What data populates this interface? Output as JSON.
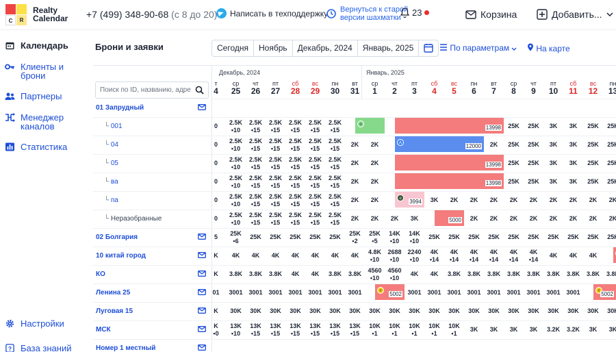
{
  "brand": {
    "line1": "Realty",
    "line2": "Calendar",
    "logo_letters": [
      "C",
      "R"
    ]
  },
  "header": {
    "phone": "+7 (499) 348-90-68",
    "hours": "(с 8 до 20)",
    "support": "Написать в техподдержку",
    "old_version_l1": "Вернуться к старой",
    "old_version_l2": "версии шахматки",
    "notifications": "23",
    "cart": "Корзина",
    "add": "Добавить..."
  },
  "sidebar": {
    "items": [
      {
        "label": "Календарь",
        "icon": "calendar-icon"
      },
      {
        "label_l1": "Клиенты и",
        "label_l2": "брони",
        "icon": "key-icon"
      },
      {
        "label": "Партнеры",
        "icon": "users-icon"
      },
      {
        "label_l1": "Менеджер",
        "label_l2": "каналов",
        "icon": "channels-icon"
      },
      {
        "label": "Статистика",
        "icon": "chart-icon"
      }
    ],
    "settings": "Настройки",
    "knowledge": "База знаний"
  },
  "toolbar": {
    "title": "Брони и заявки",
    "buttons": [
      "Сегодня",
      "Ноябрь",
      "Декабрь, 2024",
      "Январь, 2025"
    ],
    "filter": "По параметрам",
    "map": "На карте"
  },
  "search": {
    "placeholder": "Поиск по ID, названию, адре"
  },
  "months": {
    "dec": "Декабрь, 2024",
    "jan": "Январь, 2025"
  },
  "days": [
    {
      "w": "т",
      "d": "4",
      "we": false
    },
    {
      "w": "ср",
      "d": "25",
      "we": false
    },
    {
      "w": "чт",
      "d": "26",
      "we": false
    },
    {
      "w": "пт",
      "d": "27",
      "we": false
    },
    {
      "w": "сб",
      "d": "28",
      "we": true
    },
    {
      "w": "вс",
      "d": "29",
      "we": true
    },
    {
      "w": "пн",
      "d": "30",
      "we": false
    },
    {
      "w": "вт",
      "d": "31",
      "we": false
    },
    {
      "w": "ср",
      "d": "1",
      "we": false
    },
    {
      "w": "чт",
      "d": "2",
      "we": false
    },
    {
      "w": "пт",
      "d": "3",
      "we": false
    },
    {
      "w": "сб",
      "d": "4",
      "we": true
    },
    {
      "w": "вс",
      "d": "5",
      "we": true
    },
    {
      "w": "пн",
      "d": "6",
      "we": false
    },
    {
      "w": "вт",
      "d": "7",
      "we": false
    },
    {
      "w": "ср",
      "d": "8",
      "we": false
    },
    {
      "w": "чт",
      "d": "9",
      "we": false
    },
    {
      "w": "пт",
      "d": "10",
      "we": false
    },
    {
      "w": "сб",
      "d": "11",
      "we": true
    },
    {
      "w": "вс",
      "d": "12",
      "we": true
    },
    {
      "w": "пн",
      "d": "13",
      "we": false
    }
  ],
  "rows": [
    {
      "name": "01 Запрудный",
      "type": "grp",
      "mail": true,
      "cells": []
    },
    {
      "name": "001",
      "type": "sub",
      "cells": [
        "0",
        "2.5K|10",
        "2.5K|15",
        "2.5K|15",
        "2.5K|15",
        "2.5K|15",
        "2.5K|15",
        "",
        "",
        "",
        "",
        "",
        "",
        "",
        "",
        "25K",
        "25K",
        "3K",
        "3K",
        "25K",
        "25K"
      ],
      "bars": [
        {
          "from": 7,
          "to": 8,
          "color": "#86d98a",
          "badge": "о",
          "bcolor": "#86d98a"
        },
        {
          "from": 9,
          "to": 14,
          "color": "#f47c7c",
          "label": "13998"
        }
      ]
    },
    {
      "name": "04",
      "type": "sub",
      "cells": [
        "0",
        "2.5K|10",
        "2.5K|15",
        "2.5K|15",
        "2.5K|15",
        "2.5K|15",
        "2.5K|15",
        "2K",
        "2K",
        "",
        "",
        "",
        "",
        "",
        "2K",
        "25K",
        "25K",
        "3K",
        "3K",
        "25K",
        "25K"
      ],
      "bars": [
        {
          "from": 9,
          "to": 13,
          "color": "#5b8def",
          "label": "12000",
          "badge": "A",
          "bcolor": "#3b82f6"
        }
      ]
    },
    {
      "name": "05",
      "type": "sub",
      "cells": [
        "0",
        "2.5K|10",
        "2.5K|15",
        "2.5K|15",
        "2.5K|15",
        "2.5K|15",
        "2.5K|15",
        "2K",
        "2K",
        "",
        "",
        "",
        "",
        "",
        "",
        "25K",
        "25K",
        "3K",
        "3K",
        "25K",
        "25K"
      ],
      "bars": [
        {
          "from": 9,
          "to": 14,
          "color": "#f47c7c",
          "label": "13998"
        }
      ]
    },
    {
      "name": "ва",
      "type": "sub",
      "cells": [
        "0",
        "2.5K|10",
        "2.5K|15",
        "2.5K|15",
        "2.5K|15",
        "2.5K|15",
        "2.5K|15",
        "2K",
        "2K",
        "",
        "",
        "",
        "",
        "",
        "",
        "25K",
        "25K",
        "3K",
        "3K",
        "25K",
        "25K"
      ],
      "bars": [
        {
          "from": 9,
          "to": 14,
          "color": "#f47c7c",
          "label": "13998"
        }
      ]
    },
    {
      "name": "па",
      "type": "sub",
      "cells": [
        "0",
        "2.5K|10",
        "2.5K|15",
        "2.5K|15",
        "2.5K|15",
        "2.5K|15",
        "2.5K|15",
        "2K",
        "2K",
        "",
        "",
        "3K",
        "2K",
        "2K",
        "2K",
        "2K",
        "2K",
        "2K",
        "2K",
        "2K",
        "2K"
      ],
      "bars": [
        {
          "from": 9,
          "to": 10,
          "color": "#f8c6d0",
          "label": "3994",
          "badge": "о",
          "bcolor": "#2f4f2f"
        }
      ]
    },
    {
      "name": "Неразобранные",
      "type": "sub gray",
      "cells": [
        "0",
        "2.5K|10",
        "2.5K|15",
        "2.5K|15",
        "2.5K|15",
        "2.5K|15",
        "2.5K|15",
        "2K",
        "2K",
        "2K",
        "3K",
        "",
        "",
        "2K",
        "2K",
        "2K",
        "2K",
        "2K",
        "2K",
        "2K",
        "2K"
      ],
      "bars": [
        {
          "from": 11,
          "to": 12,
          "color": "#f47c7c",
          "label": "5000"
        }
      ]
    },
    {
      "name": "02 Болгария",
      "type": "grp",
      "mail": true,
      "cells": [
        "5",
        "25K|6",
        "25K",
        "25K",
        "25K",
        "25K",
        "25K",
        "25K|2",
        "25K|5",
        "14K|10",
        "14K|10",
        "25K",
        "25K",
        "25K",
        "25K",
        "25K",
        "25K",
        "25K",
        "25K",
        "25K",
        "25K"
      ]
    },
    {
      "name": "10 китай город",
      "type": "grp",
      "mail": true,
      "cells": [
        "K",
        "4K",
        "4K",
        "4K",
        "4K",
        "4K",
        "4K",
        "4K",
        "4.8K|10",
        "2688|10",
        "2240|10",
        "4K|14",
        "4K|14",
        "4K|14",
        "4K|14",
        "4K|14",
        "4K|14",
        "4K",
        "4K",
        "4K",
        ""
      ],
      "bars": [
        {
          "from": 20,
          "to": 20,
          "color": "#f47c7c",
          "badge": "к",
          "bcolor": "#facc15"
        }
      ]
    },
    {
      "name": "КО",
      "type": "grp",
      "mail": true,
      "cells": [
        "K",
        "3.8K",
        "3.8K",
        "3.8K",
        "4K",
        "4K",
        "3.8K",
        "3.8K",
        "4560|10",
        "4560|10",
        "4K",
        "4K",
        "3.8K",
        "3.8K",
        "3.8K",
        "3.8K",
        "3.8K",
        "3.8K",
        "3.8K",
        "3.8K",
        "3.8K"
      ]
    },
    {
      "name": "Ленина 25",
      "type": "grp",
      "mail": true,
      "cells": [
        "01",
        "3001",
        "3001",
        "3001",
        "3001",
        "3001",
        "3001",
        "3001",
        "",
        "",
        "3001",
        "3001",
        "3001",
        "3001",
        "3001",
        "3001",
        "3001",
        "3001",
        "3001",
        "",
        ""
      ],
      "bars": [
        {
          "from": 8,
          "to": 9,
          "color": "#f47c7c",
          "label": "5002",
          "badge": "п",
          "bcolor": "#facc15"
        },
        {
          "from": 19,
          "to": 20,
          "color": "#f47c7c",
          "label": "5002",
          "badge": "п",
          "bcolor": "#facc15"
        }
      ]
    },
    {
      "name": "Луговая 15",
      "type": "grp",
      "mail": true,
      "cells": [
        "K",
        "30K",
        "30K",
        "30K",
        "30K",
        "30K",
        "30K",
        "30K",
        "30K",
        "30K",
        "30K",
        "30K",
        "30K",
        "30K",
        "30K",
        "30K",
        "30K",
        "30K",
        "30K",
        "30K",
        "30K"
      ]
    },
    {
      "name": "МСК",
      "type": "grp",
      "mail": true,
      "cells": [
        "K|0",
        "13K|10",
        "13K|15",
        "13K|15",
        "13K|15",
        "13K|15",
        "13K|15",
        "13K|15",
        "10K|1",
        "10K|1",
        "10K|1",
        "10K|1",
        "10K|1",
        "3K",
        "3K",
        "3K",
        "3K",
        "3.2K",
        "3.2K",
        "3K",
        "3K"
      ]
    },
    {
      "name": "Номер 1 местный",
      "type": "grp",
      "mail": true,
      "cells": []
    }
  ]
}
